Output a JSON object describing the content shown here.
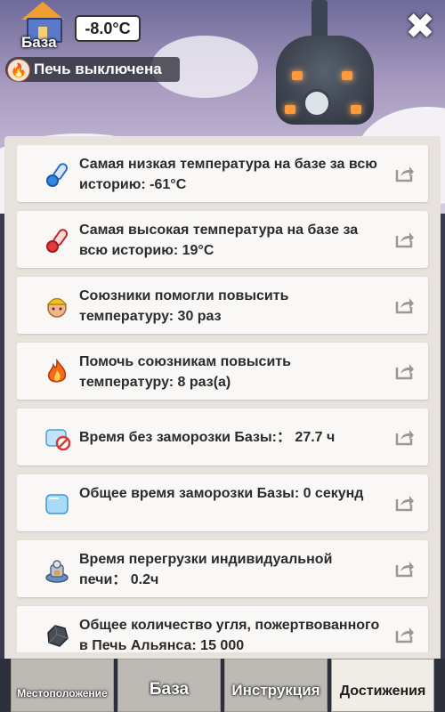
{
  "hud": {
    "temperature": "-8.0°C",
    "base_label": "База",
    "furnace_status": "Печь выключена"
  },
  "stats": [
    {
      "icon": "thermometer-cold-icon",
      "text": "Самая низкая температура на базе за всю историю: -61°C"
    },
    {
      "icon": "thermometer-hot-icon",
      "text": "Самая высокая температура на базе за всю историю: 19°C"
    },
    {
      "icon": "ally-worker-icon",
      "text": "Союзники помогли повысить температуру: 30 раз"
    },
    {
      "icon": "flame-icon",
      "text": "Помочь союзникам повысить температуру: 8 раз(а)"
    },
    {
      "icon": "no-freeze-icon",
      "text": "Время без заморозки Базы:：  27.7 ч"
    },
    {
      "icon": "ice-cube-icon",
      "text": "Общее время заморозки Базы: 0 секунд"
    },
    {
      "icon": "furnace-overload-icon",
      "text": "Время перегрузки индивидуальной печи： 0.2ч"
    },
    {
      "icon": "coal-icon",
      "text": "Общее количество угля, пожертвованного в Печь Альянса: 15 000"
    }
  ],
  "tabs": [
    {
      "label": "Местоположение",
      "active": false
    },
    {
      "label": "База",
      "active": false
    },
    {
      "label": "Инструкция",
      "active": false
    },
    {
      "label": "Достижения",
      "active": true
    }
  ],
  "colors": {
    "panel": "#e8e2dc",
    "card": "#faf8f6",
    "active_tab": "#f0ece6",
    "inactive_tab": "#bdbab6"
  }
}
